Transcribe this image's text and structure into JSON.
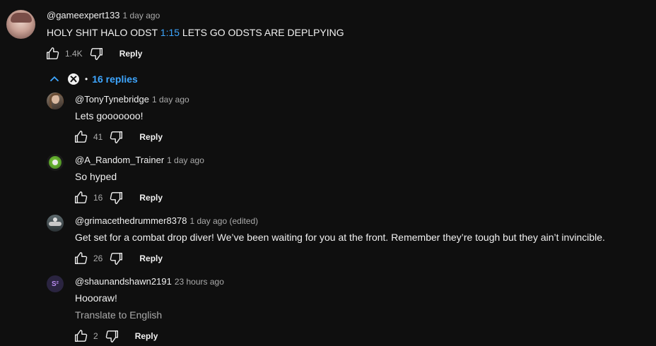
{
  "top_comment": {
    "handle": "@gameexpert133",
    "time": "1 day ago",
    "text_before": "HOLY SHIT HALO ODST ",
    "timestamp_link": "1:15",
    "text_after": "  LETS GO ODSTS ARE DEPLPYING",
    "likes": "1.4K",
    "reply_label": "Reply"
  },
  "replies_toggle": {
    "separator": "•",
    "label": "16 replies",
    "creator_icon": "xbox-logo-icon"
  },
  "replies": [
    {
      "handle": "@TonyTynebridge",
      "time": "1 day ago",
      "text": "Lets gooooooo!",
      "likes": "41",
      "reply_label": "Reply"
    },
    {
      "handle": "@A_Random_Trainer",
      "time": "1 day ago",
      "text": "So hyped",
      "likes": "16",
      "reply_label": "Reply"
    },
    {
      "handle": "@grimacethedrummer8378",
      "time": "1 day ago (edited)",
      "text": "Get set for a combat drop diver! We’ve been waiting for you at the front. Remember they’re tough but they ain’t invincible.",
      "likes": "26",
      "reply_label": "Reply"
    },
    {
      "handle": "@shaunandshawn2191",
      "time": "23 hours ago",
      "text": "Hoooraw!",
      "translate": "Translate to English",
      "likes": "2",
      "reply_label": "Reply",
      "avatar_text": "S²"
    }
  ],
  "icons": {
    "like": "thumbs-up-icon",
    "dislike": "thumbs-down-icon",
    "collapse": "chevron-up-icon"
  },
  "colors": {
    "background": "#0f0f0f",
    "link": "#3ea6ff",
    "secondary_text": "#aaaaaa"
  }
}
